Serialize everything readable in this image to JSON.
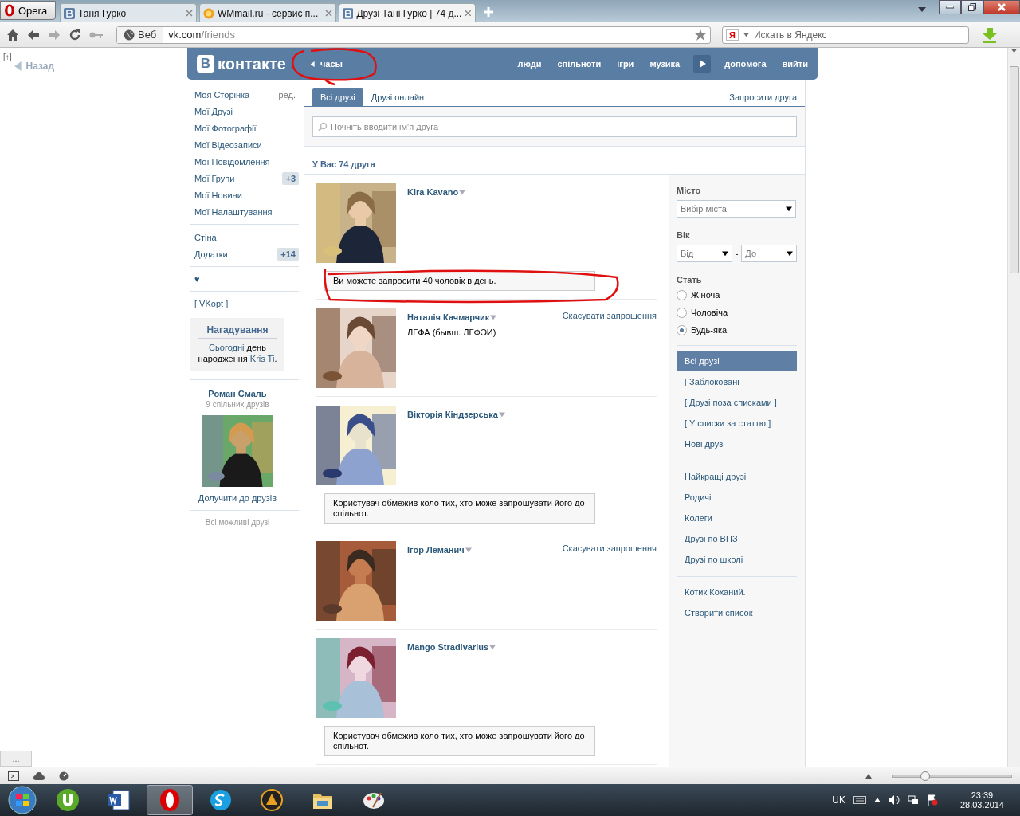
{
  "browser": {
    "menu_button": "Opera",
    "tabs": [
      {
        "label": "Таня Гурко",
        "selected": false
      },
      {
        "label": "WMmail.ru - сервис п...",
        "selected": false
      },
      {
        "label": "Друзі Тані Гурко | 74 д...",
        "selected": true
      }
    ],
    "address": {
      "scheme": "Веб",
      "domain": "vk.com",
      "path": "/friends"
    },
    "search_placeholder": "Искать в Яндекс",
    "search_badge": "Я"
  },
  "back": {
    "up": "[↑]",
    "label": "Назад"
  },
  "header": {
    "logo_mark": "В",
    "logo_text": "контакте",
    "status": "часы",
    "nav": [
      "люди",
      "спільноти",
      "ігри",
      "музика",
      "допомога",
      "вийти"
    ]
  },
  "sidebar": {
    "edit": "ред.",
    "menu": [
      {
        "label": "Моя Сторінка"
      },
      {
        "label": "Мої Друзі"
      },
      {
        "label": "Мої Фотографії"
      },
      {
        "label": "Мої Відеозаписи"
      },
      {
        "label": "Мої Повідомлення"
      },
      {
        "label": "Мої Групи",
        "badge": "+3"
      },
      {
        "label": "Мої Новини"
      },
      {
        "label": "Мої Налаштування"
      }
    ],
    "menu2": [
      {
        "label": "Стіна"
      },
      {
        "label": "Додатки",
        "badge": "+14"
      }
    ],
    "heart": "♥",
    "vkopt": "[ VKopt ]",
    "reminder": {
      "title": "Нагадування",
      "parts": [
        {
          "text": "Сьогодні",
          "link": true
        },
        {
          "text": " день народження ",
          "link": false
        },
        {
          "text": "Kris Ti",
          "link": true
        },
        {
          "text": ".",
          "link": false
        }
      ]
    },
    "suggestion": {
      "name": "Роман Смаль",
      "mutual": "9 спільних друзів",
      "action": "Долучити до друзів",
      "more": "Всі можливі друзі"
    }
  },
  "tabs": [
    {
      "label": "Всі друзі",
      "selected": true
    },
    {
      "label": "Друзі онлайн",
      "selected": false
    }
  ],
  "invite": "Запросити друга",
  "search_placeholder": "Почніть вводити ім'я друга",
  "count": "У Вас 74 друга",
  "friends": [
    {
      "name": "Kira Kavano",
      "note": "Ви можете запросити 40 чоловік в день."
    },
    {
      "name": "Наталія Качмарчик",
      "subtitle": "ЛГФА (бывш. ЛГФЭИ)",
      "action": "Скасувати запрошення"
    },
    {
      "name": "Вікторія Кіндзерська",
      "note": "Користувач обмежив коло тих, хто може запрошувати його до спільнот."
    },
    {
      "name": "Ігор Леманич",
      "action": "Скасувати запрошення"
    },
    {
      "name": "Mango Stradivarius",
      "note": "Користувач обмежив коло тих, хто може запрошувати його до спільнот."
    }
  ],
  "filters": {
    "city_label": "Місто",
    "city_placeholder": "Вибір міста",
    "age_label": "Вік",
    "age_from": "Від",
    "age_dash": "-",
    "age_to": "До",
    "gender_label": "Стать",
    "genders": [
      {
        "label": "Жіноча",
        "selected": false
      },
      {
        "label": "Чоловіча",
        "selected": false
      },
      {
        "label": "Будь-яка",
        "selected": true
      }
    ],
    "list_groups": [
      [
        {
          "label": "Всі друзі",
          "selected": true
        },
        {
          "label": "[ Заблоковані ]",
          "selected": false
        },
        {
          "label": "[ Друзі поза списками ]",
          "selected": false
        },
        {
          "label": "[ У списки за статтю ]",
          "selected": false
        },
        {
          "label": "Нові друзі",
          "selected": false
        }
      ],
      [
        {
          "label": "Найкращі друзі",
          "selected": false
        },
        {
          "label": "Родичі",
          "selected": false
        },
        {
          "label": "Колеги",
          "selected": false
        },
        {
          "label": "Друзі по ВНЗ",
          "selected": false
        },
        {
          "label": "Друзі по школі",
          "selected": false
        }
      ],
      [
        {
          "label": "Котик Коханий.",
          "selected": false
        },
        {
          "label": "Створити список",
          "selected": false
        }
      ]
    ]
  },
  "panel_toggle": "...",
  "status_bar": {
    "zoom": {
      "level": 0.27
    }
  },
  "taskbar": {
    "apps": [
      {
        "kind": "torrent",
        "selected": false
      },
      {
        "kind": "word",
        "selected": false
      },
      {
        "kind": "opera",
        "selected": true
      },
      {
        "kind": "skype",
        "selected": false
      },
      {
        "kind": "player",
        "selected": false
      },
      {
        "kind": "folder",
        "selected": false
      },
      {
        "kind": "paint",
        "selected": false
      }
    ],
    "language": "UK",
    "time": "23:39",
    "date": "28.03.2014"
  }
}
